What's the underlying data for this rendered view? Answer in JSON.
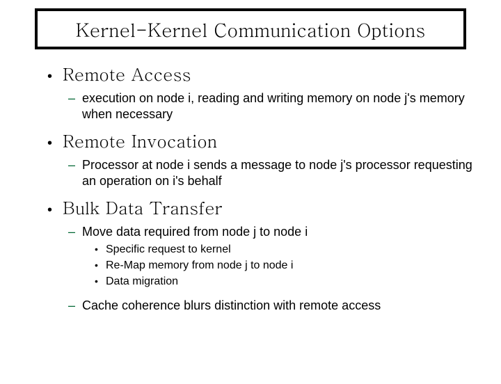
{
  "title": "Kernel-Kernel Communication Options",
  "sections": [
    {
      "heading": "Remote Access",
      "subs": [
        {
          "text": "execution on node i, reading and writing memory on node j's memory when necessary"
        }
      ]
    },
    {
      "heading": "Remote Invocation",
      "subs": [
        {
          "text": "Processor at node i sends a message to node j's processor requesting an operation on i's behalf"
        }
      ]
    },
    {
      "heading": "Bulk Data Transfer",
      "subs": [
        {
          "text": "Move data required from node j to node i",
          "subsubs": [
            "Specific request to kernel",
            "Re-Map memory from node j to node i",
            "Data migration"
          ]
        },
        {
          "text": "Cache coherence blurs distinction with remote access"
        }
      ]
    }
  ],
  "marks": {
    "bullet": "•",
    "dash": "–",
    "dot": "•"
  }
}
